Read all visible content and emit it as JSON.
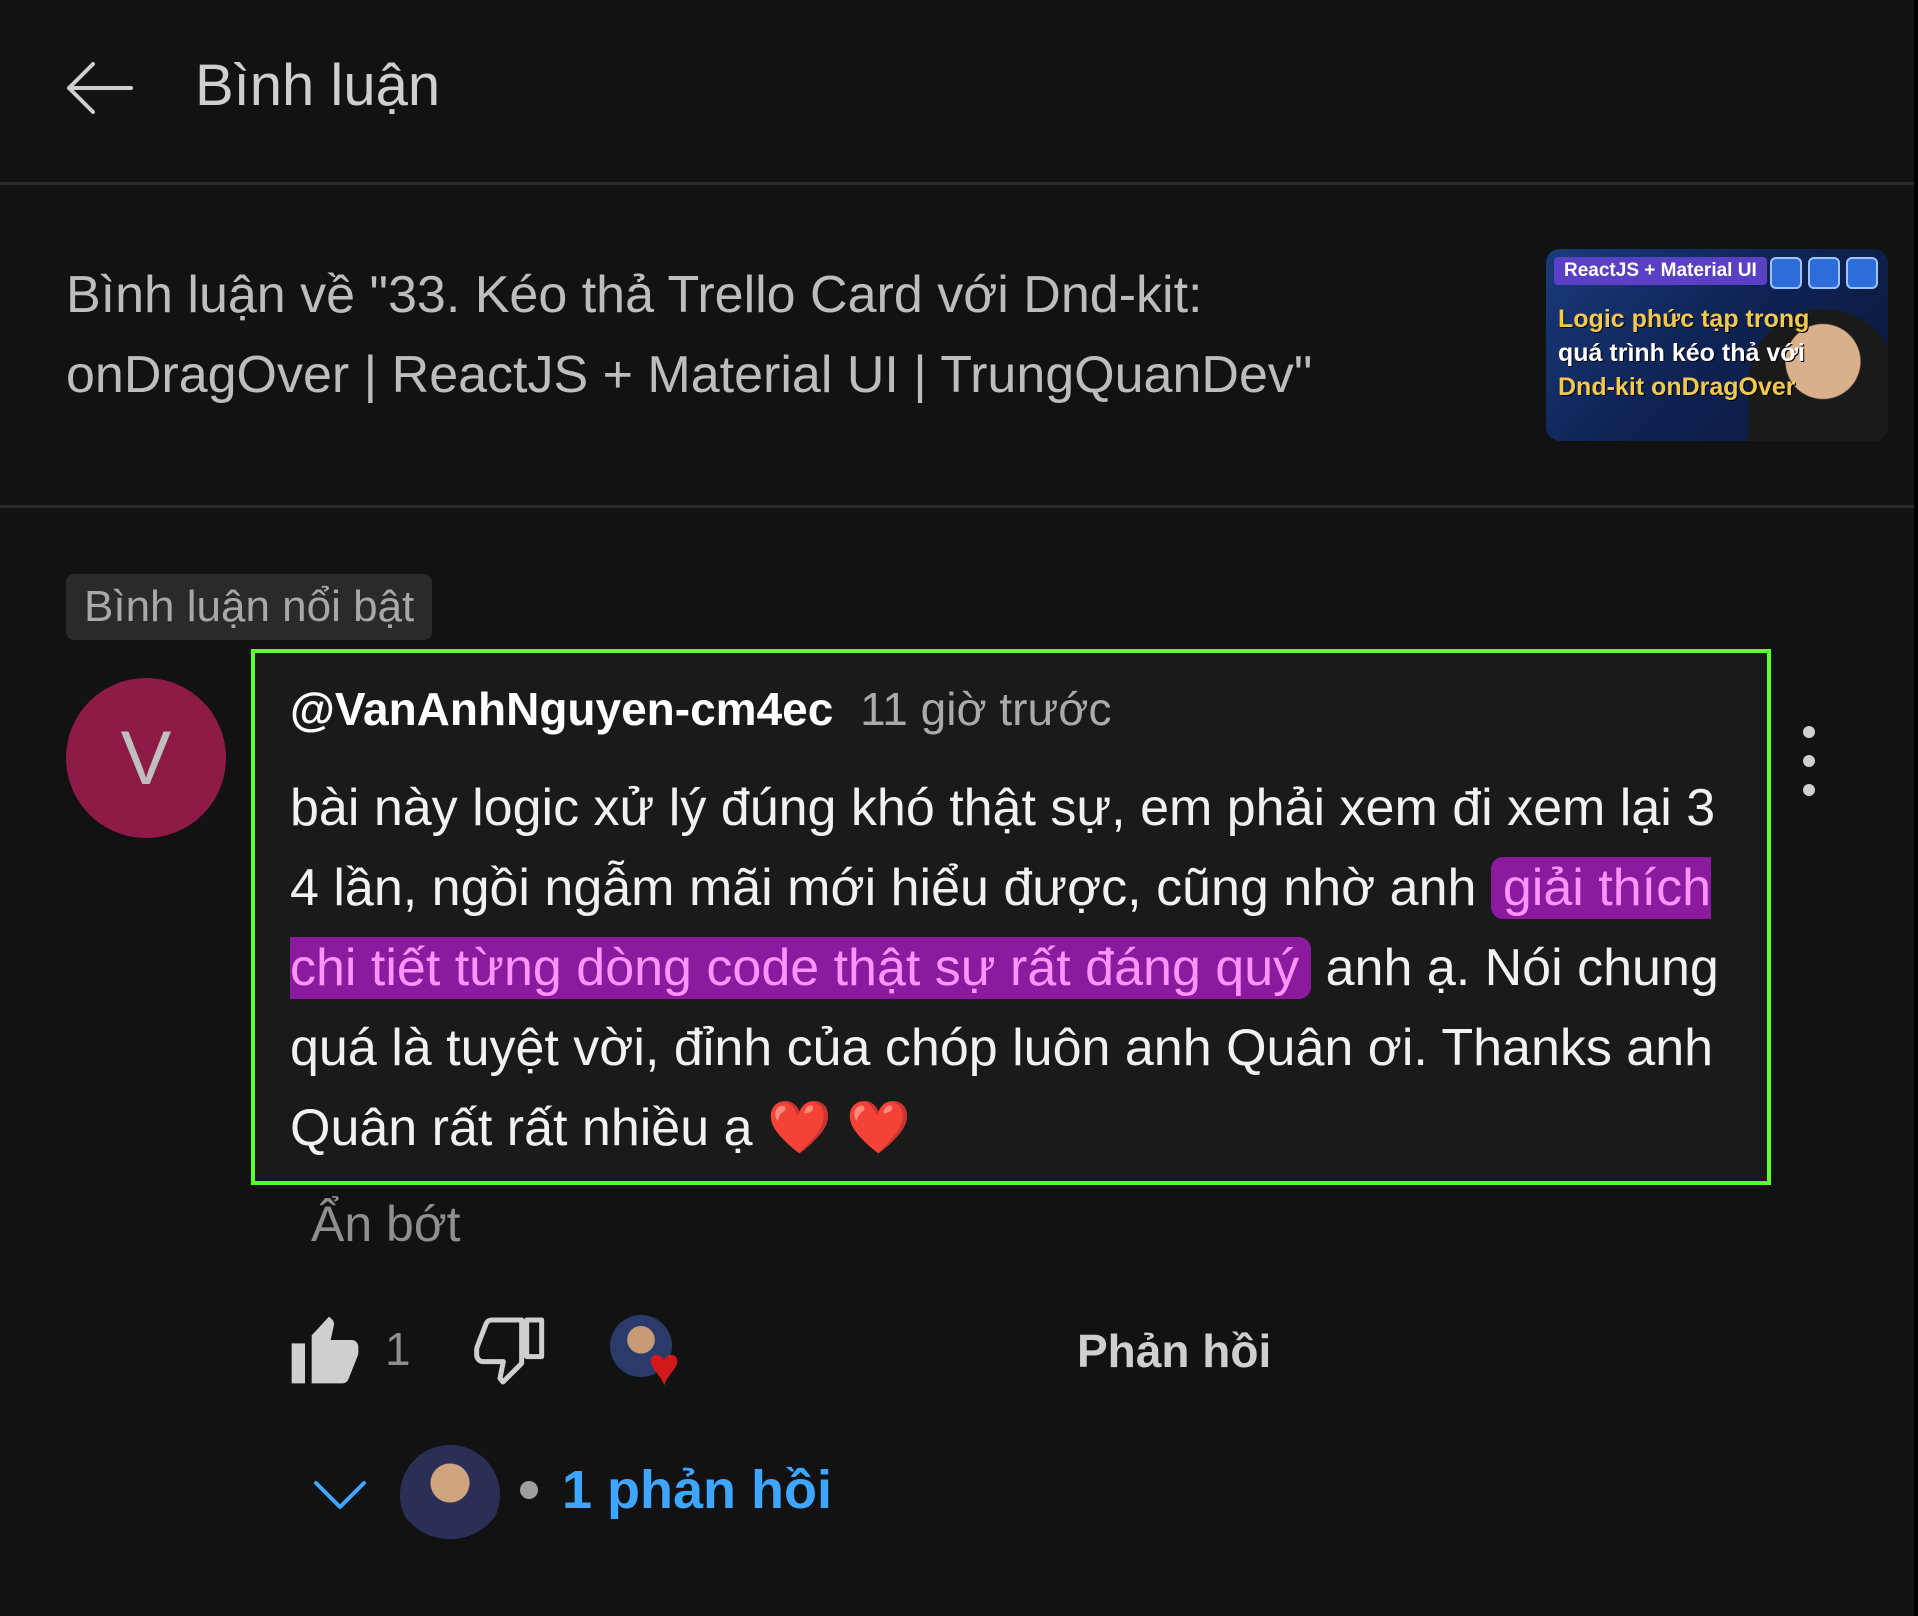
{
  "header": {
    "title": "Bình luận"
  },
  "video": {
    "title": "Bình luận về \"33. Kéo thả Trello Card với Dnd-kit: onDragOver | ReactJS + Material UI | TrungQuanDev\"",
    "thumbnail": {
      "tag": "ReactJS + Material UI",
      "line1": "Logic phức tạp trong",
      "line2": "quá trình kéo thả với",
      "line3": "Dnd-kit onDragOver"
    }
  },
  "pinned_label": "Bình luận nổi bật",
  "comment": {
    "avatar_letter": "V",
    "author": "@VanAnhNguyen-cm4ec",
    "time": "11 giờ trước",
    "text_before": "bài này logic xử lý đúng khó thật sự, em phải xem đi xem lại 3 4 lần, ngồi ngẫm mãi mới hiểu được, cũng nhờ anh",
    "text_highlight": "giải thích chi tiết từng dòng code thật sự rất đáng quý",
    "text_after": "anh ạ. Nói chung quá là tuyệt vời, đỉnh của chóp luôn anh Quân ơi. Thanks anh Quân rất rất nhiều ạ",
    "hearts": "❤️ ❤️",
    "show_less": "Ẩn bớt",
    "like_count": "1",
    "reply_label": "Phản hồi",
    "replies_count_label": "1 phản hồi"
  },
  "colors": {
    "highlight_box": "#5cff2c",
    "highlight_bg": "#8c1a9f",
    "highlight_text": "#ff94ff",
    "link_blue": "#3ea6ff",
    "avatar_bg": "#8e1a48"
  },
  "icons": [
    "back-arrow-icon",
    "kebab-menu-icon",
    "thumbs-up-icon",
    "thumbs-down-icon",
    "heart-icon",
    "chevron-down-icon"
  ]
}
